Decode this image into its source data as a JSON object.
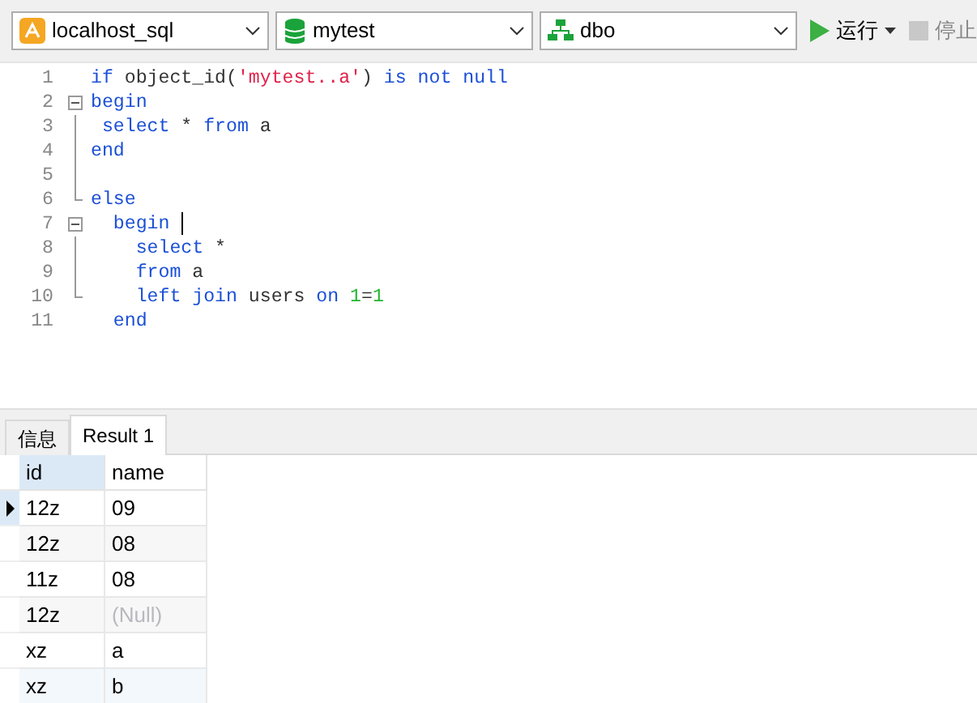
{
  "toolbar": {
    "connection": "localhost_sql",
    "database": "mytest",
    "schema": "dbo",
    "run_label": "运行",
    "stop_label": "停止",
    "stop_disabled": true
  },
  "editor": {
    "lines": [
      {
        "number": "1",
        "kind": "plain",
        "cursor": false,
        "tokens": [
          {
            "kind": "kw",
            "text": "if "
          },
          {
            "kind": "plain",
            "text": "object_id("
          },
          {
            "kind": "str",
            "text": "'mytest..a'"
          },
          {
            "kind": "plain",
            "text": ") "
          },
          {
            "kind": "kw",
            "text": "is not null"
          }
        ]
      },
      {
        "number": "2",
        "kind": "foldstart",
        "cursor": false,
        "tokens": [
          {
            "kind": "kw",
            "text": "begin"
          }
        ]
      },
      {
        "number": "3",
        "kind": "folded",
        "cursor": false,
        "tokens": [
          {
            "kind": "kw",
            "text": " select "
          },
          {
            "kind": "plain",
            "text": "* "
          },
          {
            "kind": "kw",
            "text": "from "
          },
          {
            "kind": "plain",
            "text": "a"
          }
        ]
      },
      {
        "number": "4",
        "kind": "folded",
        "cursor": false,
        "tokens": [
          {
            "kind": "kw",
            "text": "end"
          }
        ]
      },
      {
        "number": "5",
        "kind": "folded",
        "cursor": false
      },
      {
        "number": "6",
        "kind": "foldend",
        "cursor": false,
        "tokens": [
          {
            "kind": "kw",
            "text": "else"
          }
        ]
      },
      {
        "number": "7",
        "kind": "foldstart",
        "cursor": true,
        "tokens": [
          {
            "kind": "kw",
            "text": "  begin "
          }
        ]
      },
      {
        "number": "8",
        "kind": "folded",
        "cursor": false,
        "tokens": [
          {
            "kind": "kw",
            "text": "    select "
          },
          {
            "kind": "plain",
            "text": "*"
          }
        ]
      },
      {
        "number": "9",
        "kind": "folded",
        "cursor": false,
        "tokens": [
          {
            "kind": "kw",
            "text": "    from "
          },
          {
            "kind": "plain",
            "text": "a"
          }
        ]
      },
      {
        "number": "10",
        "kind": "foldend",
        "cursor": false,
        "tokens": [
          {
            "kind": "kw",
            "text": "    left join "
          },
          {
            "kind": "plain",
            "text": "users "
          },
          {
            "kind": "kw",
            "text": "on "
          },
          {
            "kind": "num",
            "text": "1"
          },
          {
            "kind": "plain",
            "text": "="
          },
          {
            "kind": "num",
            "text": "1"
          }
        ]
      },
      {
        "number": "11",
        "kind": "plain",
        "cursor": false,
        "tokens": [
          {
            "kind": "kw",
            "text": "  end"
          }
        ]
      }
    ]
  },
  "tabs": [
    {
      "label": "信息",
      "selected": false
    },
    {
      "label": "Result 1",
      "selected": true
    }
  ],
  "table": {
    "columns": [
      "id",
      "name"
    ],
    "rows": [
      {
        "current": true,
        "cells": [
          {
            "kind": "text",
            "text": "12z"
          },
          {
            "kind": "text",
            "text": "09"
          }
        ]
      },
      {
        "current": false,
        "cells": [
          {
            "kind": "text",
            "text": "12z"
          },
          {
            "kind": "text",
            "text": "08"
          }
        ]
      },
      {
        "current": false,
        "cells": [
          {
            "kind": "text",
            "text": "11z"
          },
          {
            "kind": "text",
            "text": "08"
          }
        ]
      },
      {
        "current": false,
        "cells": [
          {
            "kind": "text",
            "text": "12z"
          },
          {
            "kind": "null",
            "text": "(Null)"
          }
        ]
      },
      {
        "current": false,
        "cells": [
          {
            "kind": "text",
            "text": "xz"
          },
          {
            "kind": "text",
            "text": "a"
          }
        ]
      },
      {
        "current": false,
        "cells": [
          {
            "kind": "text",
            "text": "xz"
          },
          {
            "kind": "text",
            "text": "b"
          }
        ]
      }
    ]
  }
}
